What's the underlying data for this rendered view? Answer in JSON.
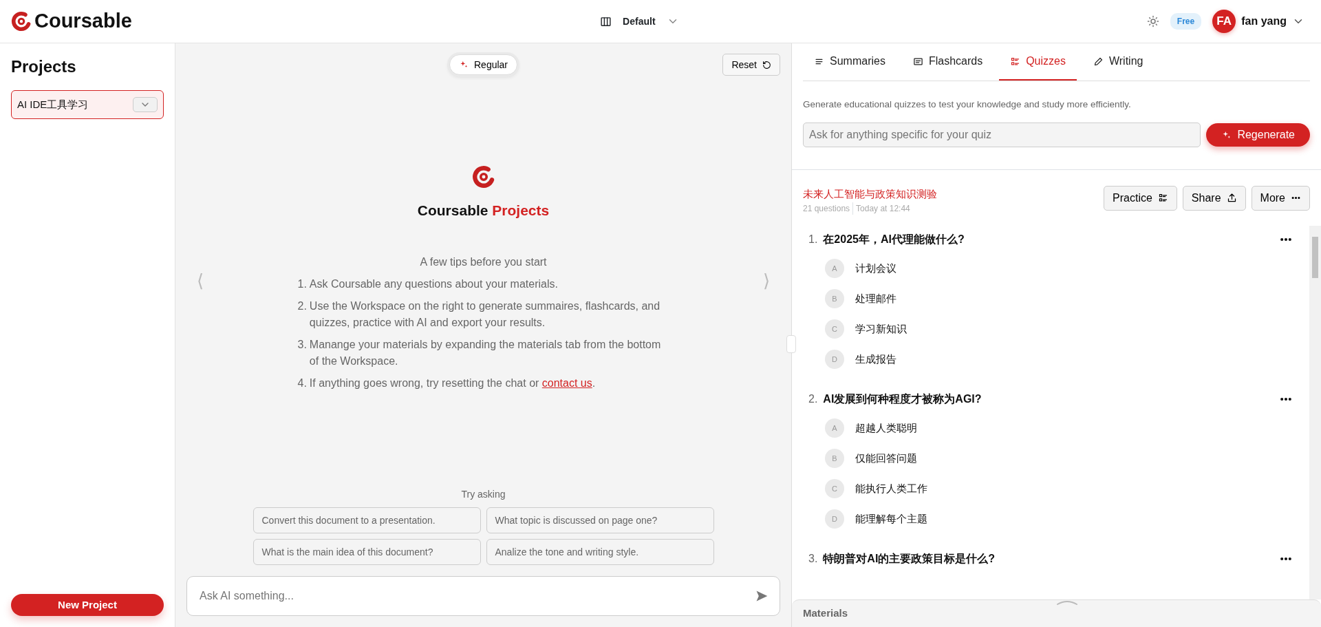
{
  "header": {
    "brand": "Coursable",
    "layout": "Default",
    "plan_badge": "Free",
    "avatar_initials": "FA",
    "user_name": "fan yang"
  },
  "sidebar": {
    "title": "Projects",
    "project_select": "AI IDE工具学习",
    "new_project_button": "New Project"
  },
  "chat": {
    "mode_button": "Regular",
    "reset_button": "Reset",
    "nav_prev": "⟨",
    "nav_next": "⟩",
    "title_brand": "Coursable",
    "title_accent": "Projects",
    "tips_heading": "A few tips before you start",
    "tips": [
      {
        "number": "1.",
        "text": "Ask Coursable any questions about your materials."
      },
      {
        "number": "2.",
        "text": "Use the Workspace on the right to generate summaires, flashcards, and quizzes, practice with AI and export your results."
      },
      {
        "number": "3.",
        "text": "Manange your materials by expanding the materials tab from the bottom of the Workspace."
      },
      {
        "number": "4.",
        "text": "If anything goes wrong, try resetting the chat or ",
        "link": "contact us",
        "after": "."
      }
    ],
    "try_asking": "Try asking",
    "suggestions": [
      "Convert this document to a presentation.",
      "What topic is discussed on page one?",
      "What is the main idea of this document?",
      "Analize the tone and writing style."
    ],
    "input_placeholder": "Ask AI something..."
  },
  "workspace": {
    "tabs": [
      {
        "label": "Summaries",
        "selected": false
      },
      {
        "label": "Flashcards",
        "selected": false
      },
      {
        "label": "Quizzes",
        "selected": true
      },
      {
        "label": "Writing",
        "selected": false
      }
    ],
    "description": "Generate educational quizzes to test your knowledge and study more efficiently.",
    "quiz_input_placeholder": "Ask for anything specific for your quiz",
    "regenerate_button": "Regenerate",
    "quiz": {
      "title": "未来人工智能与政策知识测验",
      "question_count": "21 questions",
      "time": "Today at 12:44",
      "buttons": [
        "Practice",
        "Share",
        "More"
      ],
      "questions": [
        {
          "number": "1.",
          "text": "在2025年，AI代理能做什么?",
          "options": [
            {
              "letter": "A",
              "text": "计划会议"
            },
            {
              "letter": "B",
              "text": "处理邮件"
            },
            {
              "letter": "C",
              "text": "学习新知识"
            },
            {
              "letter": "D",
              "text": "生成报告"
            }
          ]
        },
        {
          "number": "2.",
          "text": "AI发展到何种程度才被称为AGI?",
          "options": [
            {
              "letter": "A",
              "text": "超越人类聪明"
            },
            {
              "letter": "B",
              "text": "仅能回答问题"
            },
            {
              "letter": "C",
              "text": "能执行人类工作"
            },
            {
              "letter": "D",
              "text": "能理解每个主题"
            }
          ]
        },
        {
          "number": "3.",
          "text": "特朗普对AI的主要政策目标是什么?"
        }
      ]
    },
    "materials": "Materials"
  }
}
